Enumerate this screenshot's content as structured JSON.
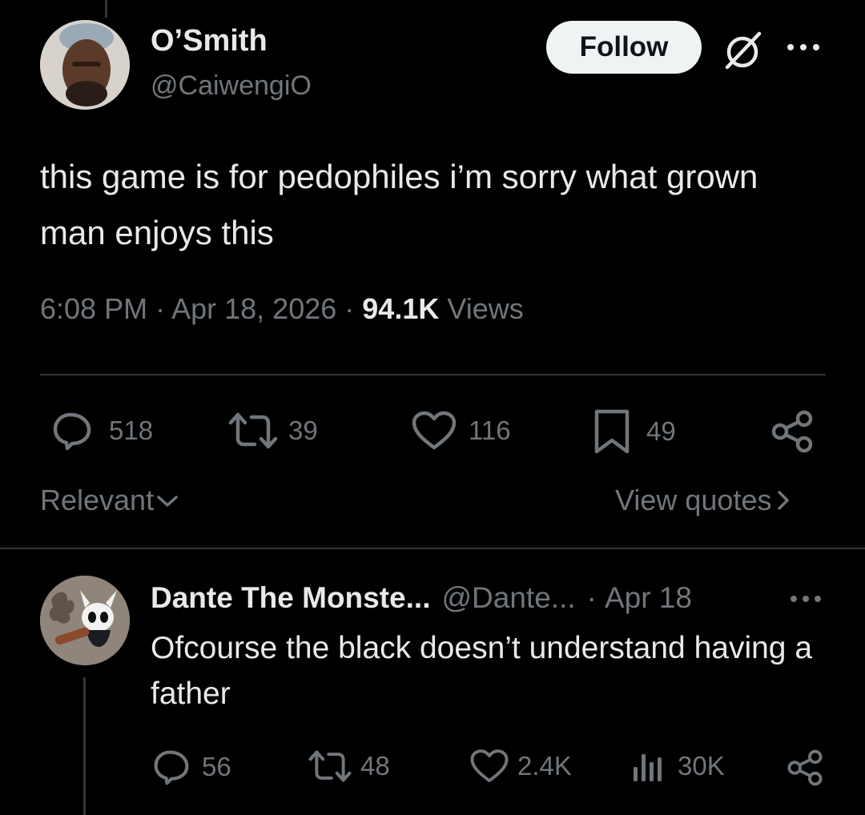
{
  "tweet": {
    "author_name": "O’Smith",
    "author_handle": "@CaiwengiO",
    "follow_label": "Follow",
    "text": "this game is for pedophiles i’m sorry what grown man enjoys this",
    "time": "6:08 PM",
    "date": "Apr 18, 2026",
    "views_count": "94.1K",
    "views_label": "Views",
    "stats": {
      "replies": "518",
      "reposts": "39",
      "likes": "116",
      "bookmarks": "49"
    },
    "icons": [
      "reply-icon",
      "repost-icon",
      "like-icon",
      "bookmark-icon",
      "share-icon",
      "grok-icon",
      "more-icon"
    ]
  },
  "sort": {
    "label": "Relevant",
    "view_quotes_label": "View quotes"
  },
  "reply": {
    "author_name": "Dante The Monste...",
    "author_handle": "@Dante...",
    "date": "Apr 18",
    "text": "Ofcourse the black doesn’t understand having a father",
    "stats": {
      "replies": "56",
      "reposts": "48",
      "likes": "2.4K",
      "views": "30K"
    },
    "icons": [
      "reply-icon",
      "repost-icon",
      "like-icon",
      "views-icon",
      "share-icon",
      "more-icon"
    ]
  },
  "colors": {
    "background": "#000000",
    "primary_text": "#e7e9ea",
    "secondary_text": "#71767b",
    "divider": "#2f3336",
    "follow_button": "#eff3f4"
  }
}
